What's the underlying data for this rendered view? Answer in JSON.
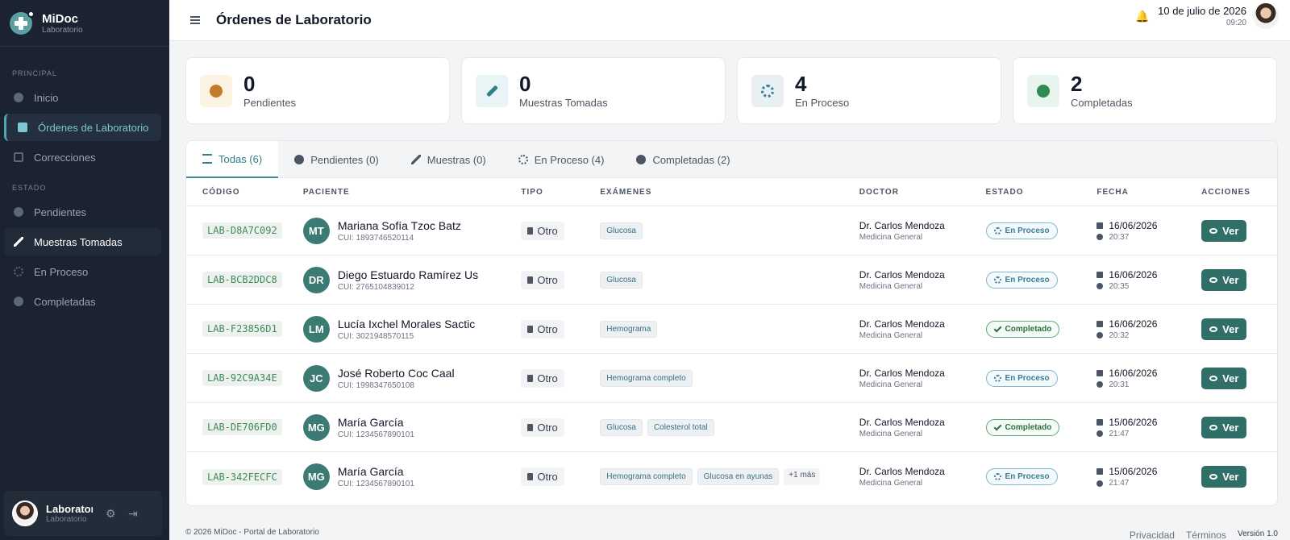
{
  "brand": {
    "name": "MiDoc",
    "subtitle": "Laboratorio"
  },
  "sidebar": {
    "section_principal": "PRINCIPAL",
    "section_estado": "ESTADO",
    "items": [
      {
        "label": "Inicio"
      },
      {
        "label": "Órdenes de Laboratorio"
      },
      {
        "label": "Correcciones"
      },
      {
        "label": "Pendientes"
      },
      {
        "label": "Muestras Tomadas"
      },
      {
        "label": "En Proceso"
      },
      {
        "label": "Completadas"
      }
    ],
    "user": {
      "name": "Laboratorio",
      "role": "Laboratorio"
    }
  },
  "header": {
    "title": "Órdenes de Laboratorio",
    "date": "10 de julio de 2026",
    "time": "09:20"
  },
  "stats": [
    {
      "value": "0",
      "label": "Pendientes",
      "icon": "clock-icon",
      "color": "#c57a2a",
      "bg": "#fdf3e3"
    },
    {
      "value": "0",
      "label": "Muestras Tomadas",
      "icon": "syringe-icon",
      "color": "#2f7f86",
      "bg": "#e8f4f6"
    },
    {
      "value": "4",
      "label": "En Proceso",
      "icon": "spinner-icon",
      "color": "#3b7e98",
      "bg": "#e9f0f3"
    },
    {
      "value": "2",
      "label": "Completadas",
      "icon": "check-circle-icon",
      "color": "#2f8a55",
      "bg": "#e8f5ec"
    }
  ],
  "tabs": [
    {
      "label": "Todas (6)"
    },
    {
      "label": "Pendientes (0)"
    },
    {
      "label": "Muestras (0)"
    },
    {
      "label": "En Proceso (4)"
    },
    {
      "label": "Completadas (2)"
    }
  ],
  "table": {
    "headers": {
      "code": "CÓDIGO",
      "patient": "PACIENTE",
      "type": "TIPO",
      "exams": "EXÁMENES",
      "doctor": "DOCTOR",
      "status": "ESTADO",
      "date": "FECHA",
      "actions": "ACCIONES"
    },
    "rows": [
      {
        "code": "LAB-D8A7C092",
        "initials": "MT",
        "name": "Mariana Sofía Tzoc Batz",
        "cui": "CUI: 1893746520114",
        "type": "Otro",
        "exams": [
          "Glucosa"
        ],
        "more": "",
        "doctor": "Dr. Carlos Mendoza",
        "specialty": "Medicina General",
        "status": "En Proceso",
        "status_kind": "proc",
        "date": "16/06/2026",
        "time": "20:37",
        "action": "Ver"
      },
      {
        "code": "LAB-BCB2DDC8",
        "initials": "DR",
        "name": "Diego Estuardo Ramírez Us",
        "cui": "CUI: 2765104839012",
        "type": "Otro",
        "exams": [
          "Glucosa"
        ],
        "more": "",
        "doctor": "Dr. Carlos Mendoza",
        "specialty": "Medicina General",
        "status": "En Proceso",
        "status_kind": "proc",
        "date": "16/06/2026",
        "time": "20:35",
        "action": "Ver"
      },
      {
        "code": "LAB-F23856D1",
        "initials": "LM",
        "name": "Lucía Ixchel Morales Sactic",
        "cui": "CUI: 3021948570115",
        "type": "Otro",
        "exams": [
          "Hemograma"
        ],
        "more": "",
        "doctor": "Dr. Carlos Mendoza",
        "specialty": "Medicina General",
        "status": "Completado",
        "status_kind": "done",
        "date": "16/06/2026",
        "time": "20:32",
        "action": "Ver"
      },
      {
        "code": "LAB-92C9A34E",
        "initials": "JC",
        "name": "José Roberto Coc Caal",
        "cui": "CUI: 1998347650108",
        "type": "Otro",
        "exams": [
          "Hemograma completo"
        ],
        "more": "",
        "doctor": "Dr. Carlos Mendoza",
        "specialty": "Medicina General",
        "status": "En Proceso",
        "status_kind": "proc",
        "date": "16/06/2026",
        "time": "20:31",
        "action": "Ver"
      },
      {
        "code": "LAB-DE706FD0",
        "initials": "MG",
        "name": "María García",
        "cui": "CUI: 1234567890101",
        "type": "Otro",
        "exams": [
          "Glucosa",
          "Colesterol total"
        ],
        "more": "",
        "doctor": "Dr. Carlos Mendoza",
        "specialty": "Medicina General",
        "status": "Completado",
        "status_kind": "done",
        "date": "15/06/2026",
        "time": "21:47",
        "action": "Ver"
      },
      {
        "code": "LAB-342FECFC",
        "initials": "MG",
        "name": "María García",
        "cui": "CUI: 1234567890101",
        "type": "Otro",
        "exams": [
          "Hemograma completo",
          "Glucosa en ayunas"
        ],
        "more": "+1 más",
        "doctor": "Dr. Carlos Mendoza",
        "specialty": "Medicina General",
        "status": "En Proceso",
        "status_kind": "proc",
        "date": "15/06/2026",
        "time": "21:47",
        "action": "Ver"
      }
    ]
  },
  "footer": {
    "copyright": "© 2026 MiDoc - Portal de Laboratorio",
    "privacy": "Privacidad",
    "terms": "Términos",
    "version": "Versión 1.0"
  }
}
